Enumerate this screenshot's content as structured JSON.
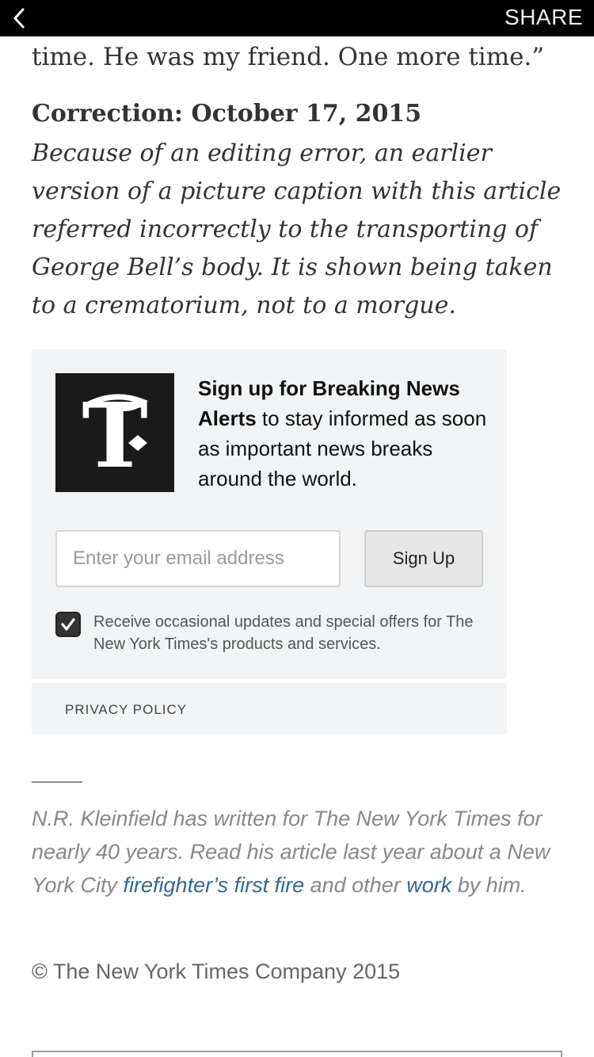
{
  "header": {
    "share_label": "SHARE"
  },
  "article": {
    "tail_text": "time. He was my friend. One more time.”",
    "correction_heading": "Correction: October 17, 2015",
    "correction_body": "Because of an editing error, an earlier version of a picture caption with this article referred incorrectly to the transporting of George Bell’s body. It is shown being taken to a crematorium, not to a morgue."
  },
  "signup": {
    "headline_bold": "Sign up for Breaking News Alerts",
    "headline_rest": " to stay informed as soon as important news breaks around the world.",
    "email_placeholder": "Enter your email address",
    "button_label": "Sign Up",
    "checkbox_checked": true,
    "checkbox_label": "Receive occasional updates and special offers for The New York Times's products and services.",
    "privacy_label": "PRIVACY POLICY"
  },
  "bio": {
    "text_1": "N.R. Kleinfield has written for The New York Times for nearly 40 years. Read his article last year about a New York City ",
    "link_1": "firefighter’s first fire",
    "text_2": " and other ",
    "link_2": "work",
    "text_3": " by him."
  },
  "footer": {
    "copyright": "© The New York Times Company 2015"
  },
  "colors": {
    "topbar": "#000000",
    "panel": "#f1f3f5",
    "link": "#326891"
  },
  "icons": {
    "back": "chevron-left-icon",
    "logo": "nyt-t-logo",
    "check": "checkmark-icon"
  }
}
